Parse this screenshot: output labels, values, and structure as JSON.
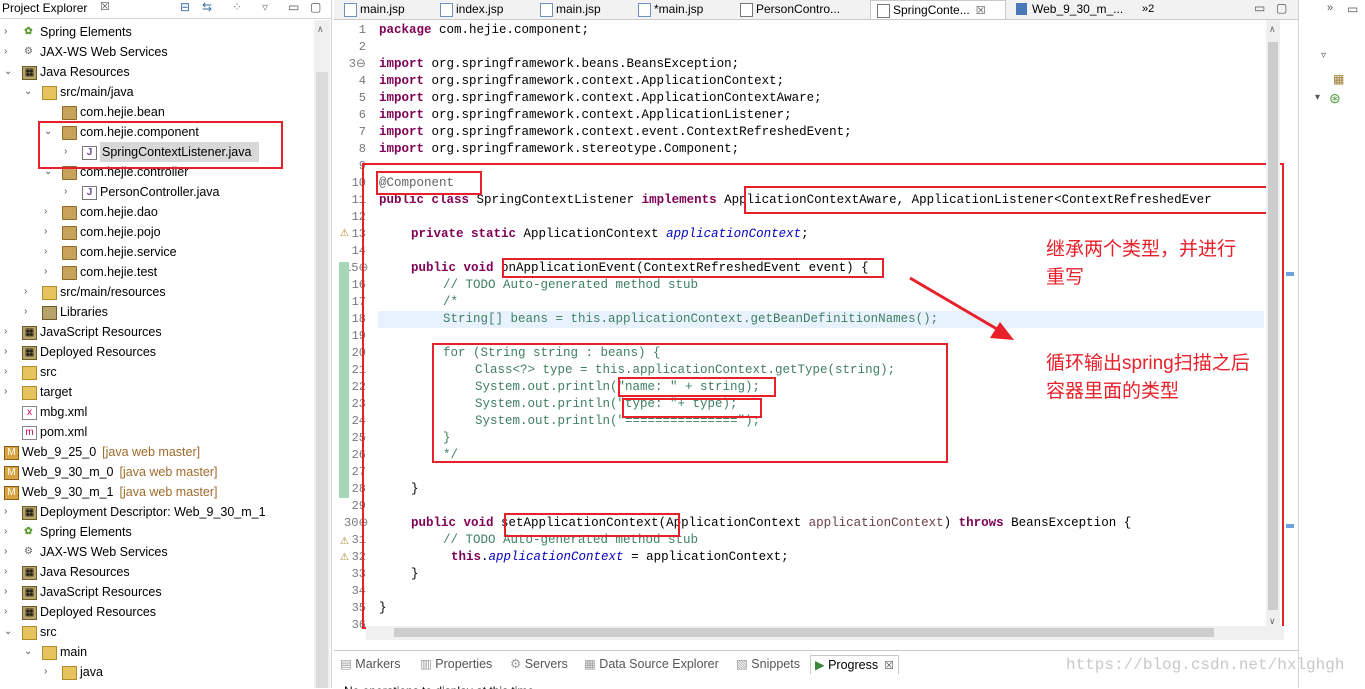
{
  "explorer": {
    "title": "Project Explorer",
    "close": "☒",
    "items": [
      {
        "label": "Spring Elements",
        "decor": ""
      },
      {
        "label": "JAX-WS Web Services",
        "decor": ""
      },
      {
        "label": "Java Resources",
        "decor": ""
      },
      {
        "label": "src/main/java",
        "decor": ""
      },
      {
        "label": "com.hejie.bean",
        "decor": ""
      },
      {
        "label": "com.hejie.component",
        "decor": ""
      },
      {
        "label": "SpringContextListener.java",
        "decor": ""
      },
      {
        "label": "com.hejie.controller",
        "decor": ""
      },
      {
        "label": "PersonController.java",
        "decor": ""
      },
      {
        "label": "com.hejie.dao",
        "decor": ""
      },
      {
        "label": "com.hejie.pojo",
        "decor": ""
      },
      {
        "label": "com.hejie.service",
        "decor": ""
      },
      {
        "label": "com.hejie.test",
        "decor": ""
      },
      {
        "label": "src/main/resources",
        "decor": ""
      },
      {
        "label": "Libraries",
        "decor": ""
      },
      {
        "label": "JavaScript Resources",
        "decor": ""
      },
      {
        "label": "Deployed Resources",
        "decor": ""
      },
      {
        "label": "src",
        "decor": ""
      },
      {
        "label": "target",
        "decor": ""
      },
      {
        "label": "mbg.xml",
        "decor": ""
      },
      {
        "label": "pom.xml",
        "decor": ""
      },
      {
        "label": "Web_9_25_0",
        "decor": "[java web master]"
      },
      {
        "label": "Web_9_30_m_0",
        "decor": "[java web master]"
      },
      {
        "label": "Web_9_30_m_1",
        "decor": "[java web master]"
      },
      {
        "label": "Deployment Descriptor: Web_9_30_m_1",
        "decor": ""
      },
      {
        "label": "Spring Elements",
        "decor": ""
      },
      {
        "label": "JAX-WS Web Services",
        "decor": ""
      },
      {
        "label": "Java Resources",
        "decor": ""
      },
      {
        "label": "JavaScript Resources",
        "decor": ""
      },
      {
        "label": "Deployed Resources",
        "decor": ""
      },
      {
        "label": "src",
        "decor": ""
      },
      {
        "label": "main",
        "decor": ""
      },
      {
        "label": "java",
        "decor": ""
      }
    ]
  },
  "tabs": [
    {
      "label": "main.jsp"
    },
    {
      "label": "index.jsp"
    },
    {
      "label": "main.jsp"
    },
    {
      "label": "*main.jsp"
    },
    {
      "label": "PersonContro..."
    },
    {
      "label": "SpringConte..."
    },
    {
      "label": "Web_9_30_m_..."
    },
    {
      "label": "»2"
    }
  ],
  "tab_close": "☒",
  "code": {
    "line_numbers": [
      "1",
      "2",
      "3⊖",
      "4",
      "5",
      "6",
      "7",
      "8",
      "9",
      "10",
      "11",
      "12",
      "13",
      "14",
      "15⊖",
      "16",
      "17",
      "18",
      "19",
      "20",
      "21",
      "22",
      "23",
      "24",
      "25",
      "26",
      "27",
      "28",
      "29",
      "30⊖",
      "31",
      "32",
      "33",
      "34",
      "35",
      "36"
    ],
    "l1a": "package",
    "l1b": " com.hejie.component;",
    "imp": "import",
    "l3": " org.springframework.beans.BeansException;",
    "l4": " org.springframework.context.ApplicationContext;",
    "l5": " org.springframework.context.ApplicationContextAware;",
    "l6": " org.springframework.context.ApplicationListener;",
    "l7": " org.springframework.context.event.ContextRefreshedEvent;",
    "l8": " org.springframework.stereotype.Component;",
    "l10": "@Component",
    "l11a": "public",
    "l11b": "class",
    "l11c": " SpringContextListener ",
    "l11d": "implements",
    "l11e": " ApplicationContextAware, ApplicationListener<ContextRefreshedEver",
    "l13a": "private",
    "l13b": "static",
    "l13c": " ApplicationContext ",
    "l13d": "applicationContext",
    "l13e": ";",
    "l15a": "public",
    "l15b": "void",
    "l15c": " onApplicationEvent(ContextRefreshedEvent event) {",
    "l16": "// TODO Auto-generated method stub",
    "l17": "/*",
    "l18": "String[] beans = this.applicationContext.getBeanDefinitionNames();",
    "l20": "for (String string : beans) {",
    "l21": "Class<?> type = this.applicationContext.getType(string);",
    "l22a": "System.out.println(",
    "l22b": "\"name: \"",
    "l22c": " + string);",
    "l23a": "System.out.println(",
    "l23b": "\"type: \"",
    "l23c": "+ type);",
    "l24a": "System.out.println(",
    "l24b": "\"===============\"",
    "l24c": ");",
    "l25": "}",
    "l26": "*/",
    "l28": "}",
    "l30a": "public",
    "l30b": "void",
    "l30c": " setApplicationContext(ApplicationContext ",
    "l30d": "applicationContext",
    "l30e": ") ",
    "l30f": "throws",
    "l30g": " BeansException {",
    "l31": "// TODO Auto-generated method stub",
    "l32a": "this",
    "l32b": ".",
    "l32c": "applicationContext",
    "l32d": " = applicationContext;",
    "l33": "}",
    "l35": "}"
  },
  "notes": {
    "note1": "继承两个类型，并进行\n重写",
    "note2": "循环输出spring扫描之后\n容器里面的类型"
  },
  "bottom": {
    "tabs": [
      "Markers",
      "Properties",
      "Servers",
      "Data Source Explorer",
      "Snippets",
      "Progress"
    ],
    "status": "No operations to display at this time."
  },
  "watermark": "https://blog.csdn.net/hxlghgh",
  "colors": {
    "annotation_red": "#e8202a",
    "keyword": "#7f0055",
    "comment": "#3f7f5f",
    "string": "#2a00ff",
    "field": "#0000c0"
  }
}
